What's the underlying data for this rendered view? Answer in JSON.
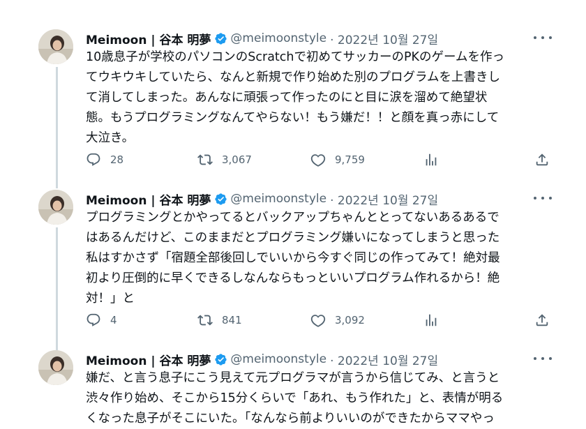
{
  "tweets": [
    {
      "name": "Meimoon | 谷本 明夢",
      "handle": "@meimoonstyle",
      "date": "· 2022년 10월 27일",
      "text": "10歳息子が学校のパソコンのScratchで初めてサッカーのPKのゲームを作っ\nてウキウキしていたら、なんと新規で作り始めた別のプログラムを上書きし\nて消してしまった。あんなに頑張って作ったのにと目に涙を溜めて絶望状\n態。もうプログラミングなんてやらない！もう嫌だ！！と顔を真っ赤にして\n大泣き。",
      "replies": "28",
      "retweets": "3,067",
      "likes": "9,759"
    },
    {
      "name": "Meimoon | 谷本 明夢",
      "handle": "@meimoonstyle",
      "date": "· 2022년 10월 27일",
      "text": "プログラミングとかやってるとバックアップちゃんととってないあるあるで\nはあるんだけど、このままだとプログラミング嫌いになってしまうと思った\n私はすかさず「宿題全部後回しでいいから今すぐ同じの作ってみて！絶対最\n初より圧倒的に早くできるしなんならもっといいプログラム作れるから！絶\n対！」と",
      "replies": "4",
      "retweets": "841",
      "likes": "3,092"
    },
    {
      "name": "Meimoon | 谷本 明夢",
      "handle": "@meimoonstyle",
      "date": "· 2022년 10월 27일",
      "text": "嫌だ、と言う息子にこう見えて元プログラマが言うから信じてみ、と言うと\n渋々作り始め、そこから15分くらいで「あれ、もう作れた」と、表情が明る\nくなった息子がそこにいた。「なんなら前よりいいのができたからママやっ"
    }
  ],
  "icons": {
    "verified": "verified-badge-icon",
    "more": "more-options-icon",
    "reply": "reply-icon",
    "retweet": "retweet-icon",
    "like": "like-icon",
    "views": "views-icon",
    "share": "share-icon"
  },
  "colors": {
    "verified": "#1d9bf0",
    "muted": "#536471",
    "text": "#0f1419",
    "thread_line": "#cfd9de"
  }
}
